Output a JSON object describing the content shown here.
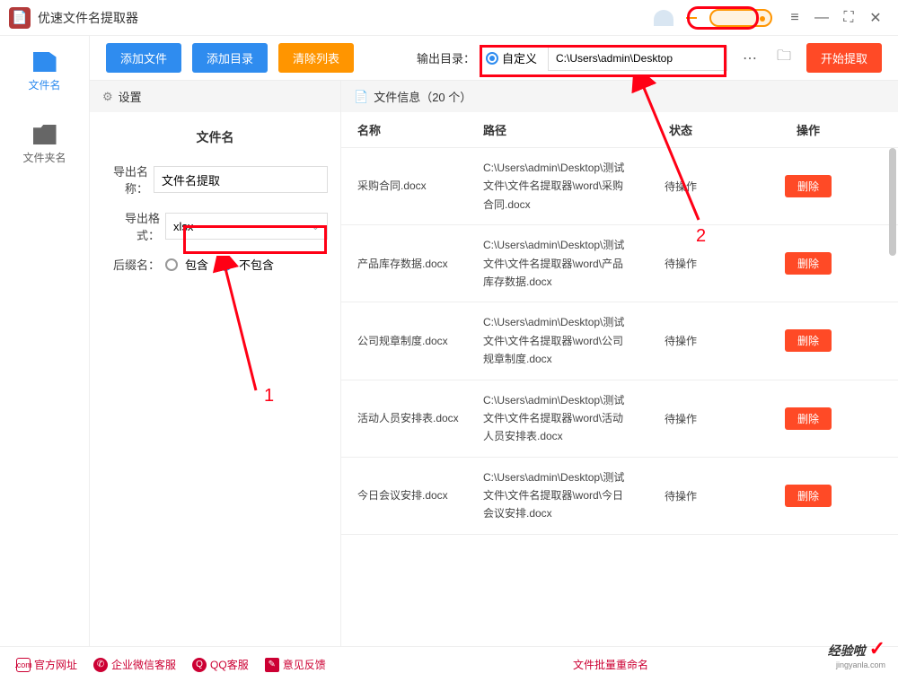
{
  "app_title": "优速文件名提取器",
  "toolbar": {
    "add_file": "添加文件",
    "add_dir": "添加目录",
    "clear": "清除列表",
    "outdir_label": "输出目录：",
    "custom_label": "自定义",
    "outdir_value": "C:\\Users\\admin\\Desktop",
    "start": "开始提取"
  },
  "sidebar": {
    "items": [
      {
        "label": "文件名"
      },
      {
        "label": "文件夹名"
      }
    ]
  },
  "settings": {
    "head": "设置",
    "group": "文件名",
    "name_label": "导出名称：",
    "name_value": "文件名提取",
    "format_label": "导出格式：",
    "format_value": "xlsx",
    "suffix_label": "后缀名：",
    "suffix_include": "包含",
    "suffix_exclude": "不包含"
  },
  "fileinfo": {
    "head": "文件信息（20 个）",
    "cols": {
      "name": "名称",
      "path": "路径",
      "status": "状态",
      "op": "操作"
    },
    "status_text": "待操作",
    "delete": "删除",
    "rows": [
      {
        "name": "采购合同.docx",
        "path": "C:\\Users\\admin\\Desktop\\测试文件\\文件名提取器\\word\\采购合同.docx"
      },
      {
        "name": "产品库存数据.docx",
        "path": "C:\\Users\\admin\\Desktop\\测试文件\\文件名提取器\\word\\产品库存数据.docx"
      },
      {
        "name": "公司规章制度.docx",
        "path": "C:\\Users\\admin\\Desktop\\测试文件\\文件名提取器\\word\\公司规章制度.docx"
      },
      {
        "name": "活动人员安排表.docx",
        "path": "C:\\Users\\admin\\Desktop\\测试文件\\文件名提取器\\word\\活动人员安排表.docx"
      },
      {
        "name": "今日会议安排.docx",
        "path": "C:\\Users\\admin\\Desktop\\测试文件\\文件名提取器\\word\\今日会议安排.docx"
      }
    ]
  },
  "footer": {
    "official": "官方网址",
    "wechat": "企业微信客服",
    "qq": "QQ客服",
    "feedback": "意见反馈",
    "rename": "文件批量重命名"
  },
  "annotations": {
    "n1": "1",
    "n2": "2"
  },
  "watermark": {
    "main": "经验啦",
    "sub": "jingyanla.com"
  }
}
